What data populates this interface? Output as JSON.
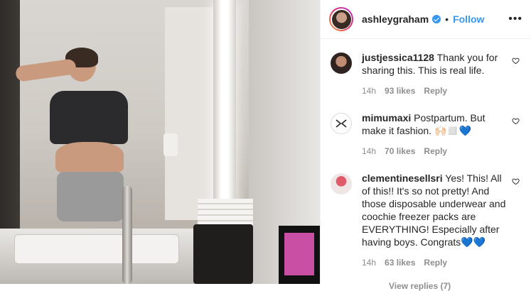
{
  "header": {
    "username": "ashleygraham",
    "separator": "•",
    "follow_label": "Follow",
    "more_label": "•••"
  },
  "comments": [
    {
      "username": "justjessica1128",
      "text": "Thank you for sharing this. This is real life.",
      "time": "14h",
      "likes": "93 likes",
      "reply": "Reply"
    },
    {
      "username": "mimumaxi",
      "text": "Postpartum. But make it fashion. 🙌🏻◻️💙",
      "time": "14h",
      "likes": "70 likes",
      "reply": "Reply"
    },
    {
      "username": "clementinesellsri",
      "text": "Yes! This! All of this!! It's so not pretty! And those disposable underwear and coochie freezer packs are EVERYTHING! Especially after having boys. Congrats💙💙",
      "time": "14h",
      "likes": "63 likes",
      "reply": "Reply",
      "view_replies": "View replies (7)"
    }
  ],
  "colors": {
    "accent": "#3897f0",
    "meta": "#8e8e8e",
    "text": "#262626"
  },
  "icons": {
    "verified": "verified-badge-icon",
    "heart": "heart-outline-icon",
    "more": "more-dots-icon"
  }
}
